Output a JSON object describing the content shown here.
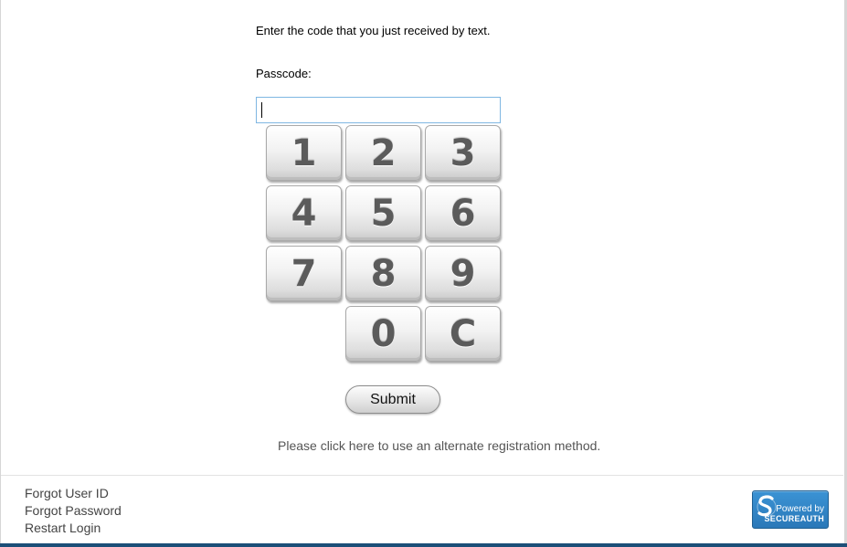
{
  "instruction_text": "Enter the code that you just received by text.",
  "passcode": {
    "label": "Passcode:",
    "value": "",
    "placeholder": ""
  },
  "keypad": {
    "keys": [
      "1",
      "2",
      "3",
      "4",
      "5",
      "6",
      "7",
      "8",
      "9",
      "0",
      "C"
    ]
  },
  "submit_label": "Submit",
  "alternate_link": "Please click here to use an alternate registration method.",
  "footer": {
    "links": [
      "Forgot User ID",
      "Forgot Password",
      "Restart Login"
    ]
  },
  "badge": {
    "powered_text": "Powered by",
    "brand": "SECUREAUTH",
    "logo_icon": "secureauth-s-logo"
  },
  "colors": {
    "accent_border": "#7fb7e2",
    "badge_blue": "#2a78b8",
    "bottom_bar": "#1c4f78"
  }
}
